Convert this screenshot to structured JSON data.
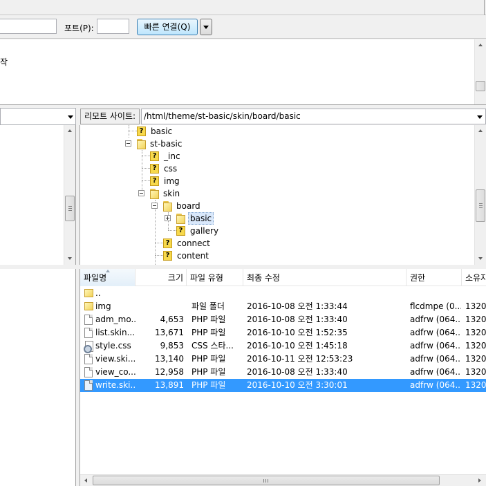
{
  "quickconnect": {
    "port_label": "포트(P):",
    "port_value": "",
    "connect_label": "빠른 연결(Q)"
  },
  "log": {
    "lines": [
      "작"
    ]
  },
  "remote": {
    "site_label": "리모트 사이트:",
    "path": "/html/theme/st-basic/skin/board/basic",
    "tree": [
      {
        "label": "basic",
        "icon": "unknown-folder-icon"
      },
      {
        "label": "st-basic",
        "icon": "folder-icon"
      },
      {
        "label": "_inc",
        "icon": "unknown-folder-icon"
      },
      {
        "label": "css",
        "icon": "unknown-folder-icon"
      },
      {
        "label": "img",
        "icon": "unknown-folder-icon"
      },
      {
        "label": "skin",
        "icon": "folder-icon"
      },
      {
        "label": "board",
        "icon": "folder-icon"
      },
      {
        "label": "basic",
        "icon": "folder-icon"
      },
      {
        "label": "gallery",
        "icon": "unknown-folder-icon"
      },
      {
        "label": "connect",
        "icon": "unknown-folder-icon"
      },
      {
        "label": "content",
        "icon": "unknown-folder-icon"
      }
    ],
    "columns": {
      "name": "파일명",
      "size": "크기",
      "type": "파일 유형",
      "modified": "최종 수정",
      "perms": "권한",
      "owner": "소유자"
    },
    "files": [
      {
        "name": "..",
        "size": "",
        "type": "",
        "modified": "",
        "perms": "",
        "owner": "",
        "icon": "folder-icon"
      },
      {
        "name": "img",
        "size": "",
        "type": "파일 폴더",
        "modified": "2016-10-08 오전 1:33:44",
        "perms": "flcdmpe (0...",
        "owner": "1320",
        "icon": "folder-icon"
      },
      {
        "name": "adm_mo...",
        "size": "4,653",
        "type": "PHP 파일",
        "modified": "2016-10-08 오전 1:33:40",
        "perms": "adfrw (064...",
        "owner": "1320",
        "icon": "file-icon"
      },
      {
        "name": "list.skin....",
        "size": "13,671",
        "type": "PHP 파일",
        "modified": "2016-10-10 오전 1:52:35",
        "perms": "adfrw (064...",
        "owner": "1320",
        "icon": "file-icon"
      },
      {
        "name": "style.css",
        "size": "9,853",
        "type": "CSS 스타...",
        "modified": "2016-10-10 오전 1:45:18",
        "perms": "adfrw (064...",
        "owner": "1320",
        "icon": "css-file-icon"
      },
      {
        "name": "view.ski...",
        "size": "13,140",
        "type": "PHP 파일",
        "modified": "2016-10-11 오전 12:53:23",
        "perms": "adfrw (064...",
        "owner": "1320",
        "icon": "file-icon"
      },
      {
        "name": "view_co...",
        "size": "12,958",
        "type": "PHP 파일",
        "modified": "2016-10-08 오전 1:33:40",
        "perms": "adfrw (064...",
        "owner": "1320",
        "icon": "file-icon"
      },
      {
        "name": "write.ski...",
        "size": "13,891",
        "type": "PHP 파일",
        "modified": "2016-10-10 오전 3:30:01",
        "perms": "adfrw (064...",
        "owner": "1320",
        "icon": "file-icon",
        "selected": true
      }
    ]
  },
  "colors": {
    "selection": "#3399ff",
    "tree_selection": "#d9e8fb"
  }
}
